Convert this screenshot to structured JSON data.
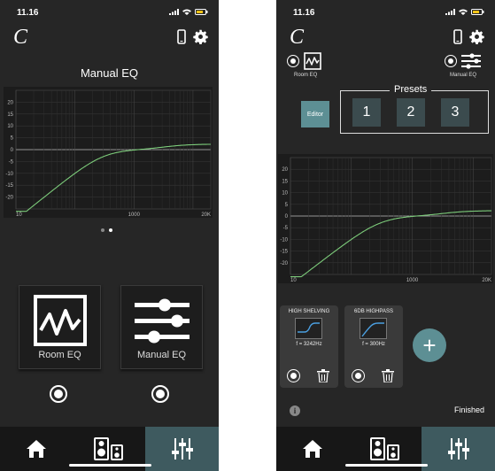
{
  "phone1": {
    "status": {
      "time": "11.16"
    },
    "logo": "C",
    "title": "Manual EQ",
    "chart": {
      "y_ticks": [
        "20",
        "15",
        "10",
        "5",
        "0",
        "-5",
        "-10",
        "-15",
        "-20"
      ],
      "x_ticks": [
        "10",
        "1000",
        "20K"
      ]
    },
    "room_eq_label": "Room EQ",
    "manual_eq_label": "Manual EQ"
  },
  "phone2": {
    "status": {
      "time": "11.16"
    },
    "logo": "C",
    "room_eq_label": "Room EQ",
    "manual_eq_label": "Manual EQ",
    "editor_label": "Editor",
    "presets_label": "Presets",
    "presets": [
      "1",
      "2",
      "3"
    ],
    "chart": {
      "y_ticks": [
        "20",
        "15",
        "10",
        "5",
        "0",
        "-5",
        "-10",
        "-15",
        "-20"
      ],
      "x_ticks": [
        "10",
        "1000",
        "20K"
      ]
    },
    "filters": [
      {
        "title": "HIGH SHELVING",
        "freq": "f = 3242Hz"
      },
      {
        "title": "6DB HIGHPASS",
        "freq": "f = 300Hz"
      }
    ],
    "plus_label": "+",
    "info_label": "i",
    "finished_label": "Finished"
  },
  "colors": {
    "background": "#262626",
    "accent": "#5d8f94",
    "curve": "#7ccb7a",
    "active_tab": "#3e5a5f"
  },
  "icons": [
    "signal-icon",
    "wifi-icon",
    "battery-icon",
    "phone-icon",
    "gear-icon",
    "home-icon",
    "speaker-icon",
    "sliders-icon",
    "trash-icon"
  ]
}
